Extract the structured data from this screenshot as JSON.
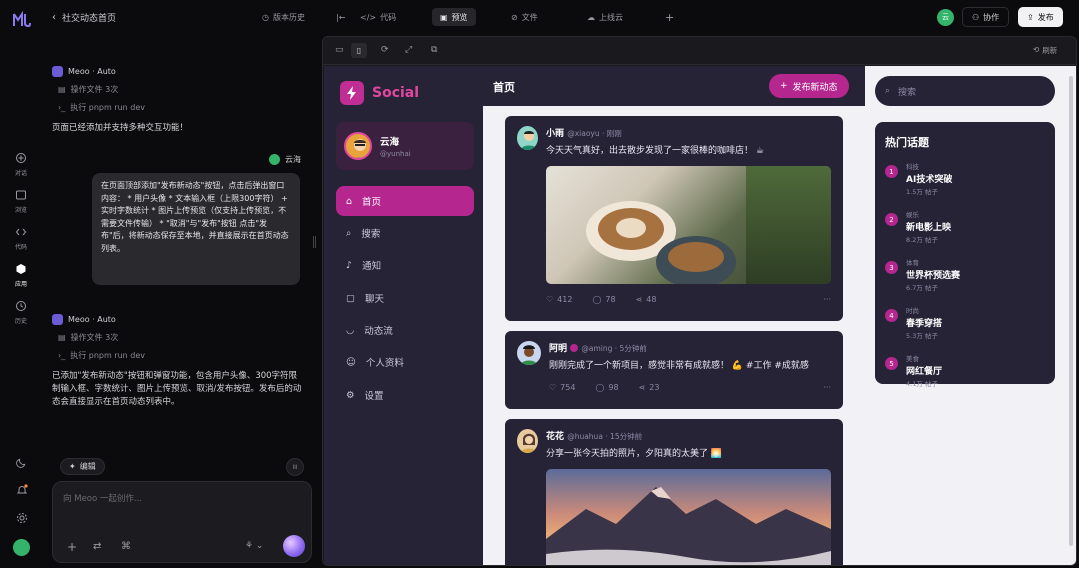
{
  "left_rail": {
    "items": [
      {
        "label": "对话"
      },
      {
        "label": "浏览"
      },
      {
        "label": "代码"
      },
      {
        "label": "应用"
      },
      {
        "label": "历史"
      }
    ]
  },
  "chat": {
    "title": "社交动态首页",
    "version_history": "版本历史",
    "messages": [
      {
        "author": "Meoo · Auto",
        "ops": [
          "操作文件 3次",
          "执行 pnpm run dev"
        ],
        "text": "页面已经添加并支持多种交互功能！"
      },
      {
        "user": "云海",
        "bubble": "在页面顶部添加\"发布新动态\"按钮，点击后弹出窗口内容：\n* 用户头像 * 文本输入框（上限300字符） + 实时字数统计 * 图片上传预览（仅支持上传预览，不需要文件传输） * \"取消\"与\"发布\"按钮 点击\"发布\"后，将新动态保存至本地，并直接展示在首页动态列表。"
      },
      {
        "author": "Meoo · Auto",
        "ops": [
          "操作文件 3次",
          "执行 pnpm run dev"
        ],
        "text": "已添加\"发布新动态\"按钮和弹窗功能，包含用户头像、300字符限制输入框、字数统计、图片上传预览、取消/发布按钮。发布后的动态会直接显示在首页动态列表中。"
      }
    ],
    "mode_chip": "编辑",
    "input_placeholder": "向 Meoo 一起创作..."
  },
  "topbar": {
    "code_tab": "代码",
    "preview_tab": "预览",
    "files_tab": "文件",
    "deploy_tab": "上线云",
    "share_label": "协作",
    "publish_label": "发布",
    "user_avatar": "云"
  },
  "frame": {
    "refresh_label": "刷新"
  },
  "app": {
    "brand": "Social",
    "profile_name": "云海",
    "profile_handle": "@yunhai",
    "nav": [
      {
        "label": "首页",
        "icon": "home-icon",
        "active": true
      },
      {
        "label": "搜索",
        "icon": "search-icon"
      },
      {
        "label": "通知",
        "icon": "bell-icon"
      },
      {
        "label": "聊天",
        "icon": "chat-icon"
      },
      {
        "label": "动态流",
        "icon": "rss-icon"
      },
      {
        "label": "个人资料",
        "icon": "user-icon"
      },
      {
        "label": "设置",
        "icon": "gear-icon"
      }
    ],
    "page_title": "首页",
    "new_post_button": "发布新动态",
    "search_placeholder": "搜索",
    "trending_title": "热门话题",
    "trending": [
      {
        "rank": "1",
        "category": "科技",
        "title": "AI技术突破",
        "count": "1.5万 帖子"
      },
      {
        "rank": "2",
        "category": "娱乐",
        "title": "新电影上映",
        "count": "8.2万 帖子"
      },
      {
        "rank": "3",
        "category": "体育",
        "title": "世界杯预选赛",
        "count": "6.7万 帖子"
      },
      {
        "rank": "4",
        "category": "时尚",
        "title": "春季穿搭",
        "count": "5.3万 帖子"
      },
      {
        "rank": "5",
        "category": "美食",
        "title": "网红餐厅",
        "count": "4.1万 帖子"
      }
    ],
    "posts": [
      {
        "name": "小雨",
        "handle": "@xiaoyu · 刚刚",
        "text": "今天天气真好，出去散步发现了一家很棒的咖啡店！ ☕",
        "likes": "412",
        "comments": "78",
        "shares": "48"
      },
      {
        "name": "阿明",
        "handle": "@aming · 5分钟前",
        "text": "刚刚完成了一个新项目，感觉非常有成就感！ 💪 #工作 #成就感",
        "likes": "754",
        "comments": "98",
        "shares": "23"
      },
      {
        "name": "花花",
        "handle": "@huahua · 15分钟前",
        "text": "分享一张今天拍的照片，夕阳真的太美了 🌅"
      }
    ]
  }
}
